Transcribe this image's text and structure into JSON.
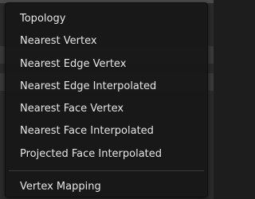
{
  "menu": {
    "items": [
      {
        "label": "Topology"
      },
      {
        "label": "Nearest Vertex"
      },
      {
        "label": "Nearest Edge Vertex"
      },
      {
        "label": "Nearest Edge Interpolated"
      },
      {
        "label": "Nearest Face Vertex"
      },
      {
        "label": "Nearest Face Interpolated"
      },
      {
        "label": "Projected Face Interpolated"
      }
    ],
    "footer_item": {
      "label": "Vertex Mapping"
    }
  }
}
